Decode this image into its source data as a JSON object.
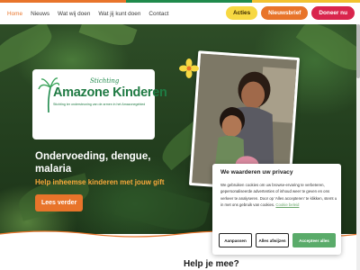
{
  "nav": {
    "items": [
      {
        "label": "Home",
        "active": true
      },
      {
        "label": "Nieuws"
      },
      {
        "label": "Wat wij doen"
      },
      {
        "label": "Wat jij kunt doen"
      },
      {
        "label": "Contact"
      }
    ]
  },
  "header_actions": {
    "acties": "Acties",
    "nieuwsbrief": "Nieuwsbrief",
    "doneer": "Doneer nu"
  },
  "logo": {
    "stichting": "Stichting",
    "title": "Amazone Kinderen",
    "tagline": "Stichting ter ondersteuning van de armen in het Amazonegebied"
  },
  "hero": {
    "title": "Ondervoeding, dengue, malaria",
    "subtitle": "Help inheemse kinderen met jouw gift",
    "cta": "Lees verder"
  },
  "cookie": {
    "title": "We waarderen uw privacy",
    "text": "We gebruiken cookies om uw browse-ervaring te verbeteren, gepersonaliseerde advertenties of inhoud weer te geven en ons verkeer te analyseren. Door op 'Alles accepteren' te klikken, stemt u in met ons gebruik van cookies.",
    "link": "Cookie beleid",
    "customize": "Aanpassen",
    "reject": "Alles afwijzen",
    "accept": "Accepteer alles"
  },
  "section": {
    "help_title": "Help je mee?"
  },
  "colors": {
    "orange": "#e8742a",
    "green": "#1f8a4c",
    "yellow": "#f7d842",
    "red": "#d9254d"
  }
}
